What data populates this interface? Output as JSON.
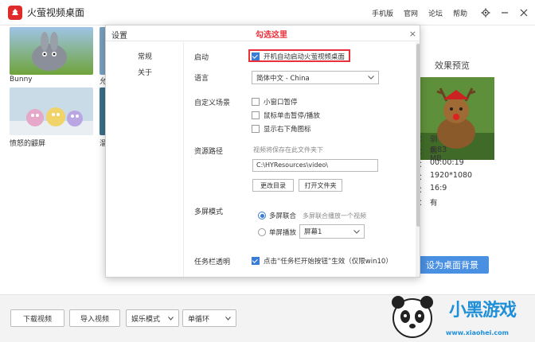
{
  "app": {
    "title": "火萤视频桌面"
  },
  "top_nav": {
    "items": [
      "手机版",
      "官网",
      "论坛",
      "帮助"
    ]
  },
  "library": {
    "items": [
      {
        "label": "Bunny"
      },
      {
        "label": "允"
      },
      {
        "label": "愤怒的鼹屏"
      },
      {
        "label": "溜"
      }
    ]
  },
  "preview": {
    "title": "效果预览",
    "info": [
      {
        "k": "：",
        "v": "驯鹿"
      },
      {
        "k": "：",
        "v": "6.83 MB"
      },
      {
        "k": "：",
        "v": "00:00:19"
      },
      {
        "k": "：",
        "v": "1920*1080"
      },
      {
        "k": "：",
        "v": "16:9"
      },
      {
        "k": "：",
        "v": "有"
      }
    ],
    "set_bg_label": "设为桌面背景"
  },
  "bottom": {
    "download_label": "下载视频",
    "import_label": "导入视频",
    "mode_select": "娱乐模式",
    "loop_select": "单循环"
  },
  "watermark": {
    "text": "小黑游戏",
    "url": "www.xiaohei.com"
  },
  "dialog": {
    "title": "设置",
    "note": "勾选这里",
    "close": "×",
    "tabs": [
      "常规",
      "关于"
    ],
    "startup": {
      "label": "启动",
      "option": "开机自动启动火萤视频桌面",
      "checked": true
    },
    "language": {
      "label": "语言",
      "value": "简体中文 - China"
    },
    "custom": {
      "label": "自定义场景",
      "options": [
        {
          "text": "小窗口暂停",
          "checked": false
        },
        {
          "text": "鼠标单击暂停/播放",
          "checked": false
        },
        {
          "text": "显示右下角图标",
          "checked": false
        }
      ]
    },
    "resource": {
      "label": "资源路径",
      "hint": "视频将保存在此文件夹下",
      "path": "C:\\HYResources\\video\\",
      "change_btn": "更改目录",
      "open_btn": "打开文件夹"
    },
    "multiscreen": {
      "label": "多屏模式",
      "option1": "多屏联合",
      "option1_hint": "多屏联合播放一个视频",
      "option2": "单屏播放",
      "screen_value": "屏幕1"
    },
    "taskbar": {
      "label": "任务栏透明",
      "option": "点击“任务栏开始按钮”生效（仅限win10）"
    }
  }
}
